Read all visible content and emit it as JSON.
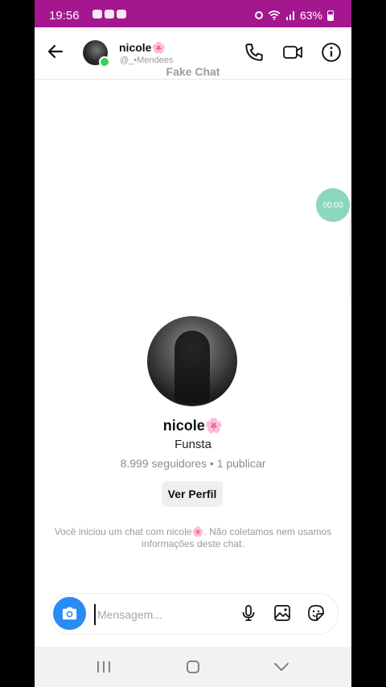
{
  "status": {
    "time": "19:56",
    "battery": "63%"
  },
  "header": {
    "name": "nicole🌸",
    "username": "@_•Mendees",
    "subtitle": "Fake Chat"
  },
  "timer": "00:00",
  "profile": {
    "name": "nicole🌸",
    "bio": "Funsta",
    "stats": "8.999 seguidores • 1 publicar",
    "button_label": "Ver Perfil"
  },
  "notice": "Você iniciou um chat com nicole🌸. Não coletamos nem usamos informações deste chat.",
  "composer": {
    "placeholder": "Mensagem..."
  },
  "colors": {
    "status_bar": "#a4178f",
    "camera": "#2a8bf2",
    "online": "#36d15a",
    "timer": "#7fd3b7"
  }
}
